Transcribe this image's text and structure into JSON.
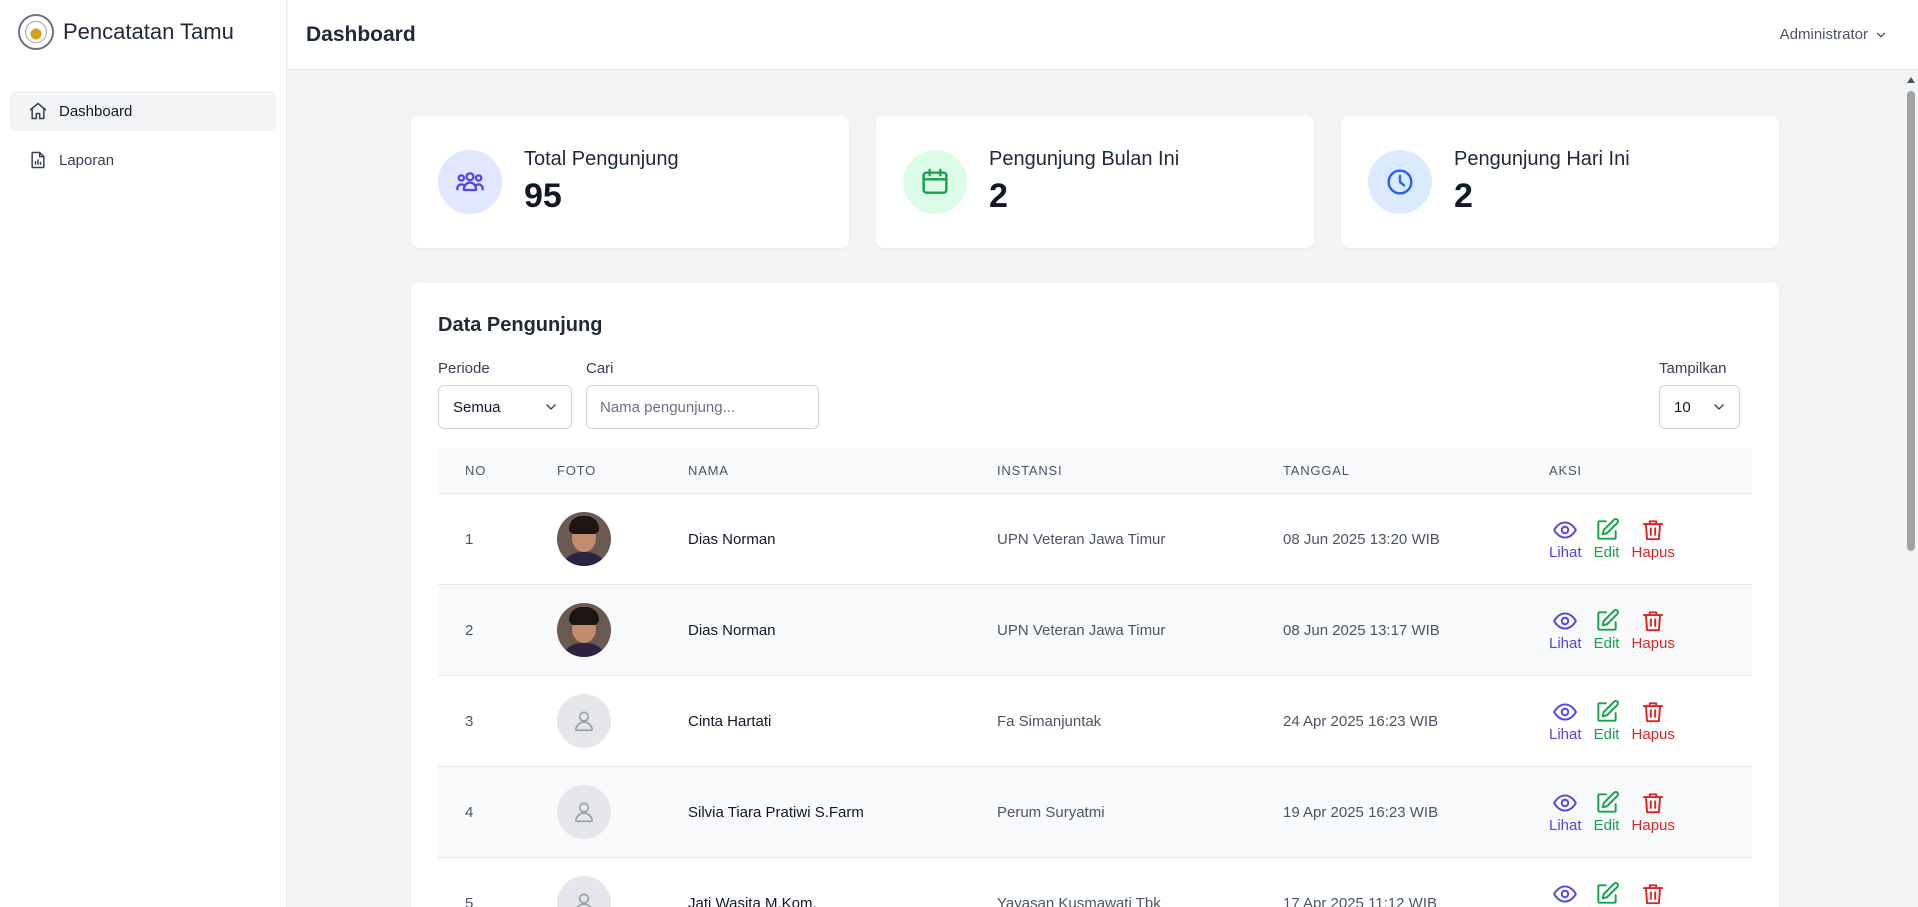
{
  "app": {
    "name": "Pencatatan Tamu"
  },
  "sidebar": {
    "items": [
      {
        "label": "Dashboard",
        "icon": "home-icon",
        "active": true
      },
      {
        "label": "Laporan",
        "icon": "report-icon",
        "active": false
      }
    ]
  },
  "header": {
    "title": "Dashboard",
    "user": "Administrator"
  },
  "stats": [
    {
      "label": "Total Pengunjung",
      "value": "95",
      "icon": "users-icon",
      "color": "#4f46e5",
      "bg": "#e0e7ff"
    },
    {
      "label": "Pengunjung Bulan Ini",
      "value": "2",
      "icon": "calendar-icon",
      "color": "#16a34a",
      "bg": "#dcfce7"
    },
    {
      "label": "Pengunjung Hari Ini",
      "value": "2",
      "icon": "clock-icon",
      "color": "#2563eb",
      "bg": "#dbeafe"
    }
  ],
  "panel": {
    "title": "Data Pengunjung",
    "period_label": "Periode",
    "period_value": "Semua",
    "search_label": "Cari",
    "search_placeholder": "Nama pengunjung...",
    "show_label": "Tampilkan",
    "show_value": "10"
  },
  "table": {
    "headers": {
      "no": "NO",
      "foto": "FOTO",
      "nama": "NAMA",
      "instansi": "INSTANSI",
      "tanggal": "TANGGAL",
      "aksi": "AKSI"
    },
    "actions": {
      "view": "Lihat",
      "edit": "Edit",
      "delete": "Hapus"
    },
    "rows": [
      {
        "no": "1",
        "nama": "Dias Norman",
        "instansi": "UPN Veteran Jawa Timur",
        "tanggal": "08 Jun 2025 13:20 WIB",
        "photo": true
      },
      {
        "no": "2",
        "nama": "Dias Norman",
        "instansi": "UPN Veteran Jawa Timur",
        "tanggal": "08 Jun 2025 13:17 WIB",
        "photo": true
      },
      {
        "no": "3",
        "nama": "Cinta Hartati",
        "instansi": "Fa Simanjuntak",
        "tanggal": "24 Apr 2025 16:23 WIB",
        "photo": false
      },
      {
        "no": "4",
        "nama": "Silvia Tiara Pratiwi S.Farm",
        "instansi": "Perum Suryatmi",
        "tanggal": "19 Apr 2025 16:23 WIB",
        "photo": false
      },
      {
        "no": "5",
        "nama": "Jati Wasita M.Kom.",
        "instansi": "Yayasan Kusmawati Tbk",
        "tanggal": "17 Apr 2025 11:12 WIB",
        "photo": false
      }
    ]
  }
}
